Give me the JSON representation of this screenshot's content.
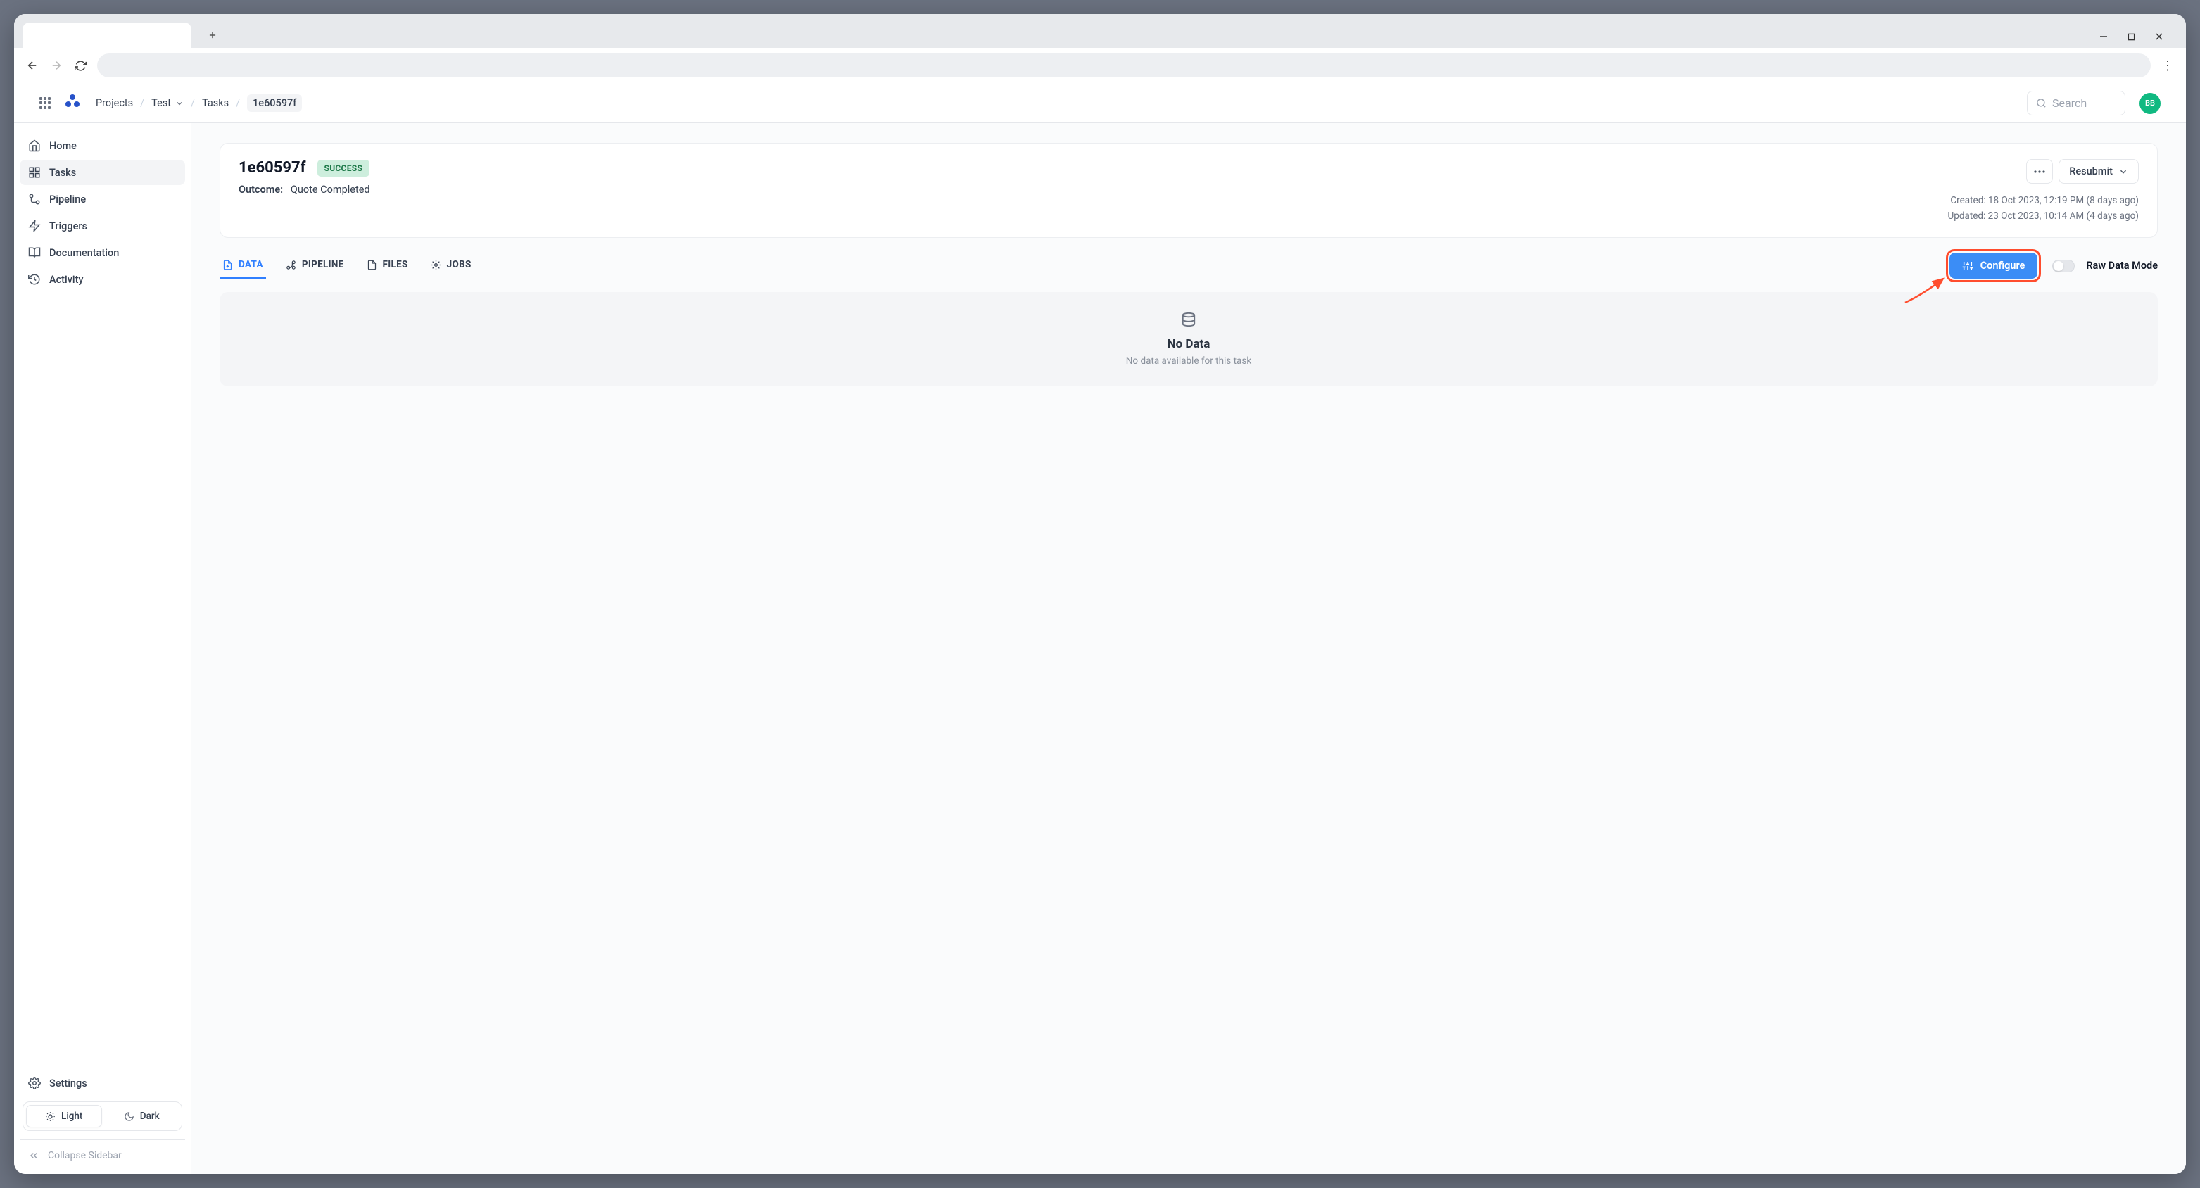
{
  "breadcrumb": {
    "items": [
      {
        "label": "Projects"
      },
      {
        "label": "Test",
        "has_dropdown": true
      },
      {
        "label": "Tasks"
      },
      {
        "label": "1e60597f",
        "current": true
      }
    ]
  },
  "search": {
    "placeholder": "Search"
  },
  "avatar": {
    "initials": "BB"
  },
  "sidebar": {
    "items": [
      {
        "label": "Home",
        "icon": "home-icon"
      },
      {
        "label": "Tasks",
        "icon": "grid-icon",
        "active": true
      },
      {
        "label": "Pipeline",
        "icon": "pipeline-icon"
      },
      {
        "label": "Triggers",
        "icon": "bolt-icon"
      },
      {
        "label": "Documentation",
        "icon": "book-icon"
      },
      {
        "label": "Activity",
        "icon": "history-icon"
      }
    ],
    "settings_label": "Settings",
    "theme": {
      "light": "Light",
      "dark": "Dark"
    },
    "collapse_label": "Collapse Sidebar"
  },
  "task": {
    "id": "1e60597f",
    "status": "SUCCESS",
    "outcome_label": "Outcome:",
    "outcome_value": "Quote Completed",
    "resubmit_label": "Resubmit",
    "created_label": "Created: 18 Oct 2023, 12:19 PM (8 days ago)",
    "updated_label": "Updated: 23 Oct 2023, 10:14 AM (4 days ago)"
  },
  "tabs": [
    {
      "label": "DATA",
      "active": true
    },
    {
      "label": "PIPELINE"
    },
    {
      "label": "FILES"
    },
    {
      "label": "JOBS"
    }
  ],
  "configure_label": "Configure",
  "raw_mode_label": "Raw Data Mode",
  "empty": {
    "title": "No Data",
    "subtitle": "No data available for this task"
  }
}
